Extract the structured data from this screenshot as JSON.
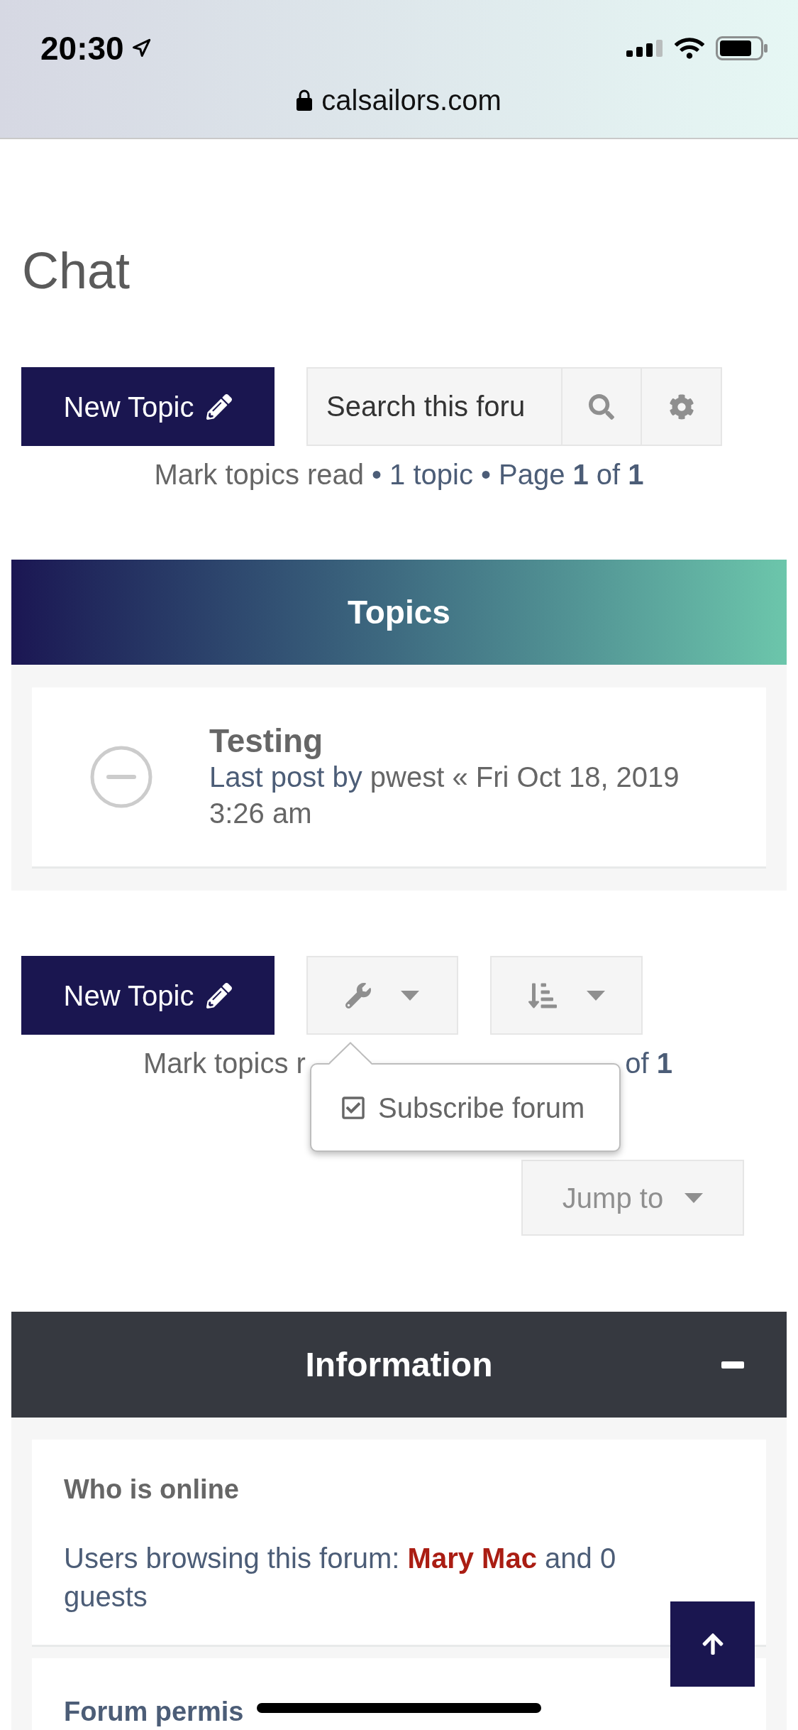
{
  "status_bar": {
    "time": "20:30"
  },
  "address_bar": {
    "url": "calsailors.com"
  },
  "page_title": "Chat",
  "top_toolbar": {
    "new_topic_button": "New Topic",
    "search": {
      "placeholder": "Search this foru"
    }
  },
  "pagination_top": [
    {
      "kind": "link",
      "text": "Mark topics read"
    },
    {
      "kind": "separator",
      "text": "•"
    },
    {
      "kind": "count",
      "text": "1 topic"
    },
    {
      "kind": "separator",
      "text": "•"
    },
    {
      "kind": "pages",
      "text": "Page **1** of **1**"
    }
  ],
  "topics": {
    "title": "Topics",
    "rows": [
      {
        "title": "Testing",
        "last_post_label": "Last post by",
        "author": "pwest",
        "date": "« Fri Oct 18, 2019 3:26 am"
      }
    ]
  },
  "bottom_toolbar": {
    "new_topic_button": "New Topic",
    "tools_menu": {
      "expanded": true,
      "items": [
        {
          "label": "Subscribe forum"
        }
      ]
    }
  },
  "pagination_bottom": [
    {
      "kind": "link",
      "text": "Mark topics r"
    },
    {
      "kind": "pages",
      "text": "of **1**"
    }
  ],
  "jump_to": {
    "label": "Jump to"
  },
  "information": {
    "title": "Information",
    "expanded": true,
    "sections": [
      {
        "kind": "online",
        "heading": "Who is online",
        "text": "Users browsing this forum:",
        "user": "Mary Mac",
        "text_after": "and 0 guests"
      },
      {
        "kind": "permissions",
        "heading": "Forum permis"
      }
    ]
  }
}
